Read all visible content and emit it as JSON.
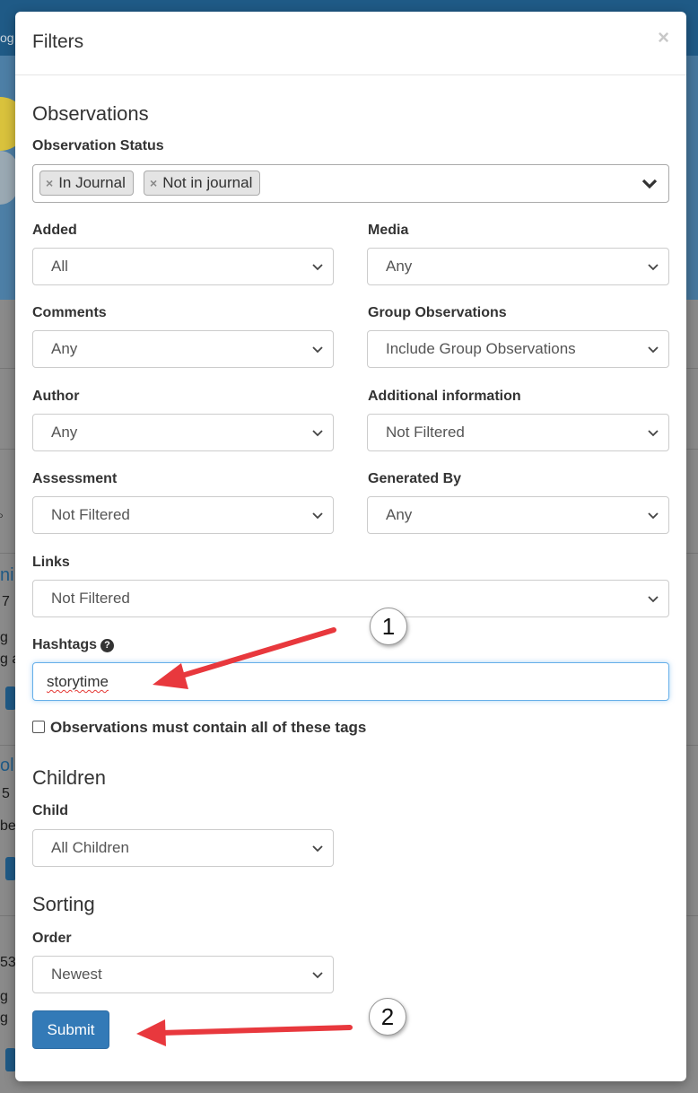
{
  "modal": {
    "title": "Filters",
    "close_glyph": "×"
  },
  "observations": {
    "section_title": "Observations",
    "status_label": "Observation Status",
    "status_tags": [
      "In Journal",
      "Not in journal"
    ],
    "tag_remove_glyph": "×"
  },
  "filters": {
    "added": {
      "label": "Added",
      "value": "All"
    },
    "media": {
      "label": "Media",
      "value": "Any"
    },
    "comments": {
      "label": "Comments",
      "value": "Any"
    },
    "group_observations": {
      "label": "Group Observations",
      "value": "Include Group Observations"
    },
    "author": {
      "label": "Author",
      "value": "Any"
    },
    "additional_info": {
      "label": "Additional information",
      "value": "Not Filtered"
    },
    "assessment": {
      "label": "Assessment",
      "value": "Not Filtered"
    },
    "generated_by": {
      "label": "Generated By",
      "value": "Any"
    },
    "links": {
      "label": "Links",
      "value": "Not Filtered"
    }
  },
  "hashtags": {
    "label": "Hashtags",
    "help_glyph": "?",
    "value": "storytime",
    "match_all_label": "Observations must contain all of these tags",
    "match_all_checked": false
  },
  "children": {
    "section_title": "Children",
    "child_label": "Child",
    "child_value": "All Children"
  },
  "sorting": {
    "section_title": "Sorting",
    "order_label": "Order",
    "order_value": "Newest"
  },
  "submit_label": "Submit",
  "annotations": {
    "step1": "1",
    "step2": "2",
    "arrow_color": "#e8383d"
  },
  "background": {
    "topbar_text": "og",
    "fragments": [
      "ni",
      "7",
      "g",
      "g a",
      "ol",
      "5",
      "be",
      "53",
      "g",
      "g"
    ]
  }
}
